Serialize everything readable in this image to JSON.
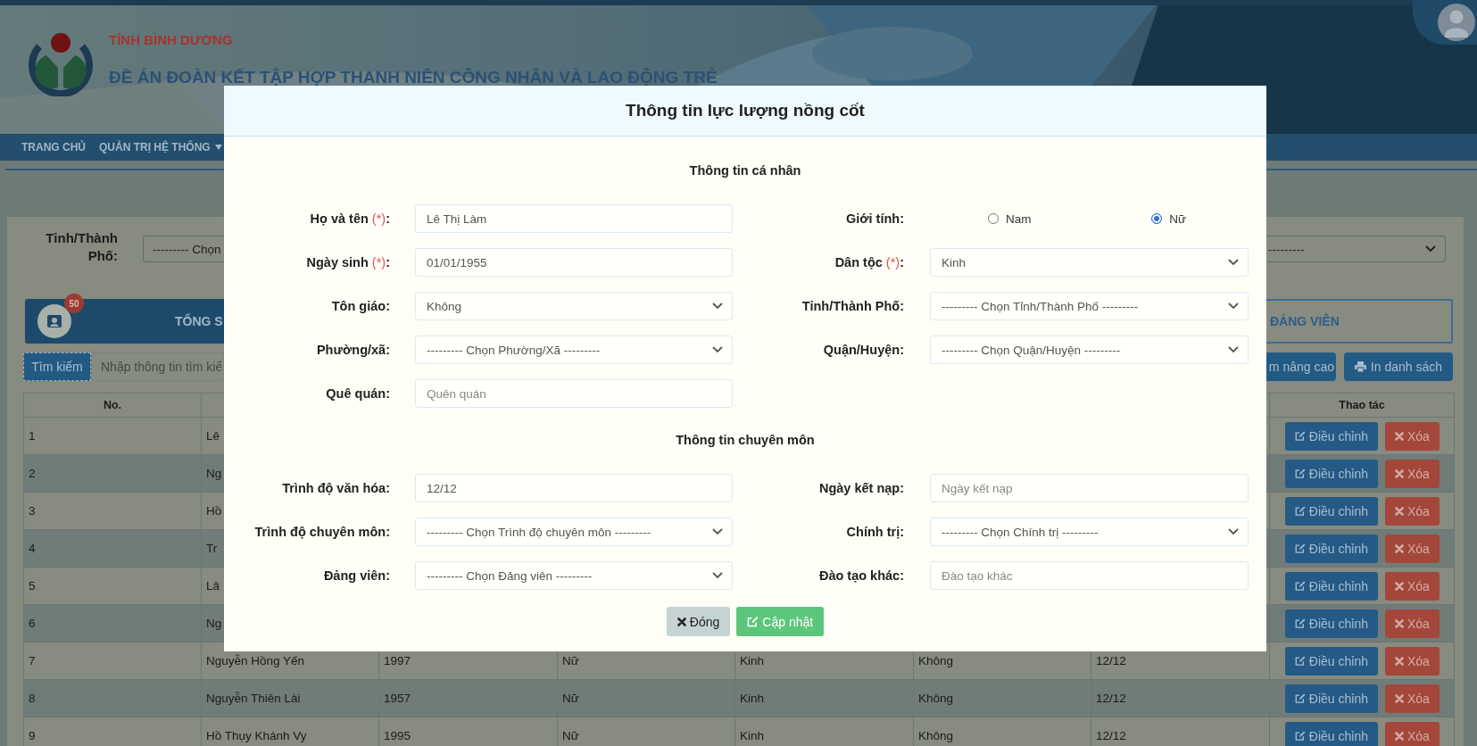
{
  "header": {
    "province": "TỈNH BÌNH DƯƠNG",
    "title": "ĐỀ ÁN ĐOÀN KẾT TẬP HỢP THANH NIÊN CÔNG NHÂN VÀ LAO ĐỘNG TRẺ"
  },
  "nav": {
    "items": [
      {
        "label": "TRANG CHỦ",
        "has_menu": false
      },
      {
        "label": "QUẢN TRỊ HỆ THỐNG",
        "has_menu": true
      }
    ]
  },
  "filters": [
    {
      "label": "Tỉnh/Thành Phố:",
      "value": "--------- Chọn"
    },
    {
      "value": "---------"
    }
  ],
  "stat_cards": [
    {
      "kind": "solid",
      "badge": "50",
      "label": "TỔNG S"
    },
    {
      "kind": "outline",
      "label": "ĐẢNG VIÊN"
    }
  ],
  "search": {
    "button": "Tìm kiếm",
    "placeholder": "Nhập thông tin tìm kiế"
  },
  "toolbar_buttons": [
    {
      "label": "m nâng cao",
      "kind": "search"
    },
    {
      "label": "In danh sách",
      "kind": "print"
    }
  ],
  "table": {
    "columns": [
      "No.",
      "Thao tác"
    ],
    "rows": [
      {
        "cells": [
          "1",
          "Lê"
        ],
        "actions": [
          {
            "kind": "edit",
            "label": "Điều chỉnh"
          },
          {
            "kind": "delete",
            "label": "Xóa"
          }
        ]
      },
      {
        "cells": [
          "2",
          "Ng"
        ],
        "actions": [
          {
            "kind": "edit",
            "label": "Điều chỉnh"
          },
          {
            "kind": "delete",
            "label": "Xóa"
          }
        ]
      },
      {
        "cells": [
          "3",
          "Hồ"
        ],
        "actions": [
          {
            "kind": "edit",
            "label": "Điều chỉnh"
          },
          {
            "kind": "delete",
            "label": "Xóa"
          }
        ]
      },
      {
        "cells": [
          "4",
          "Tr"
        ],
        "actions": [
          {
            "kind": "edit",
            "label": "Điều chỉnh"
          },
          {
            "kind": "delete",
            "label": "Xóa"
          }
        ]
      },
      {
        "cells": [
          "5",
          "Lâ"
        ],
        "actions": [
          {
            "kind": "edit",
            "label": "Điều chỉnh"
          },
          {
            "kind": "delete",
            "label": "Xóa"
          }
        ]
      },
      {
        "cells": [
          "6",
          "Ng"
        ],
        "actions": [
          {
            "kind": "edit",
            "label": "Điều chỉnh"
          },
          {
            "kind": "delete",
            "label": "Xóa"
          }
        ]
      },
      {
        "cells": [
          "7",
          "Nguyễn Hồng Yến",
          "1997",
          "Nữ",
          "Kinh",
          "Không",
          "12/12"
        ],
        "actions": [
          {
            "kind": "edit",
            "label": "Điều chỉnh"
          },
          {
            "kind": "delete",
            "label": "Xóa"
          }
        ]
      },
      {
        "cells": [
          "8",
          "Nguyễn Thiên Lài",
          "1957",
          "Nữ",
          "Kinh",
          "Không",
          "12/12"
        ],
        "actions": [
          {
            "kind": "edit",
            "label": "Điều chỉnh"
          },
          {
            "kind": "delete",
            "label": "Xóa"
          }
        ]
      },
      {
        "cells": [
          "9",
          "Hồ Thụy Khánh Vy",
          "1995",
          "Nữ",
          "Kinh",
          "Không",
          "12/12"
        ],
        "actions": [
          {
            "kind": "edit",
            "label": "Điều chỉnh"
          },
          {
            "kind": "delete",
            "label": "Xóa"
          }
        ]
      }
    ]
  },
  "modal": {
    "title": "Thông tin lực lượng nồng cốt",
    "sections": [
      {
        "title": "Thông tin cá nhân",
        "fields": [
          {
            "label": [
              "Họ và tên ",
              "(*)",
              ":"
            ],
            "kind": "input",
            "value": "Lê Thị Làm"
          },
          {
            "label": [
              "Giới tính:"
            ],
            "kind": "radio",
            "options": [
              {
                "label": "Nam",
                "selected": false
              },
              {
                "label": "Nữ",
                "selected": true
              }
            ]
          },
          {
            "label": [
              "Ngày sinh ",
              "(*)",
              ":"
            ],
            "kind": "input",
            "value": "01/01/1955"
          },
          {
            "label": [
              "Dân tộc ",
              "(*)",
              ":"
            ],
            "kind": "select",
            "value": "Kinh"
          },
          {
            "label": [
              "Tôn giáo:"
            ],
            "kind": "select",
            "value": "Không"
          },
          {
            "label": [
              "Tỉnh/Thành Phố:"
            ],
            "kind": "select",
            "value": "--------- Chọn Tỉnh/Thành Phố ---------"
          },
          {
            "label": [
              "Phường/xã:"
            ],
            "kind": "select",
            "value": "--------- Chọn Phường/Xã ---------"
          },
          {
            "label": [
              "Quận/Huyện:"
            ],
            "kind": "select",
            "value": "--------- Chọn Quận/Huyện ---------"
          },
          {
            "label": [
              "Quê quán:"
            ],
            "kind": "input",
            "placeholder": "Quên quán"
          }
        ]
      },
      {
        "title": "Thông tin chuyên môn",
        "fields": [
          {
            "label": [
              "Trình độ văn hóa:"
            ],
            "kind": "input",
            "value": "12/12"
          },
          {
            "label": [
              "Ngày kết nạp:"
            ],
            "kind": "input",
            "placeholder": "Ngày kết nạp"
          },
          {
            "label": [
              "Trình độ chuyên môn:"
            ],
            "kind": "select",
            "value": "--------- Chọn Trình độ chuyên môn ---------"
          },
          {
            "label": [
              "Chính trị:"
            ],
            "kind": "select",
            "value": "--------- Chọn Chính trị ---------"
          },
          {
            "label": [
              "Đảng viên:"
            ],
            "kind": "select",
            "value": "--------- Chọn Đảng viên ---------"
          },
          {
            "label": [
              "Đào tạo khác:"
            ],
            "kind": "input",
            "placeholder": "Đào tạo khác"
          }
        ]
      }
    ],
    "buttons": [
      {
        "kind": "close",
        "label": "Đóng"
      },
      {
        "kind": "save",
        "label": "Cập nhật"
      }
    ]
  }
}
